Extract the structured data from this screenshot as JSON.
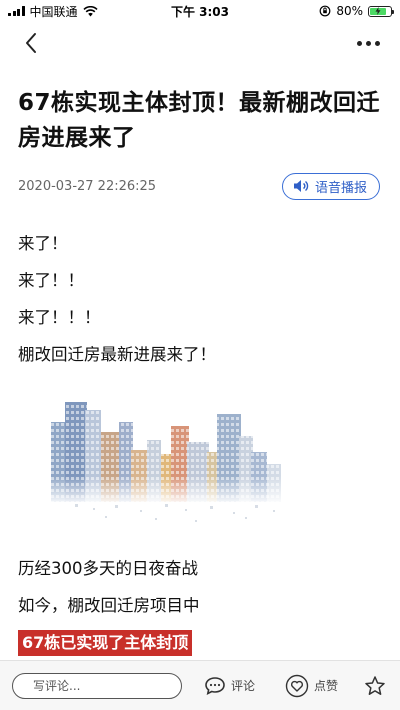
{
  "status_bar": {
    "carrier": "中国联通",
    "time": "下午 3:03",
    "battery_percent": "80%",
    "battery_level": 0.8
  },
  "nav": {
    "back_icon": "chevron-left-icon",
    "more_icon": "more-dots-icon"
  },
  "article": {
    "title": "67栋实现主体封顶！最新棚改回迁房进展来了",
    "date": "2020-03-27 22:26:25",
    "voice_button_label": "语音播报",
    "paragraphs": [
      "来了！",
      "来了！！",
      "来了！！！",
      "棚改回迁房最新进展来了！",
      "历经300多天的日夜奋战",
      "如今，棚改回迁房项目中"
    ],
    "highlight": "67栋已实现了主体封顶"
  },
  "bottom_bar": {
    "comment_placeholder": "写评论...",
    "comment_label": "评论",
    "like_label": "点赞"
  },
  "colors": {
    "accent_blue": "#2f5fc7",
    "highlight_red": "#c8302a",
    "battery_green": "#4cd964"
  }
}
